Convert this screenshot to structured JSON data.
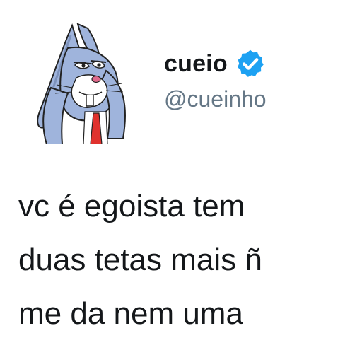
{
  "tweet": {
    "author": {
      "display_name": "cueio",
      "handle": "@cueinho",
      "verified": true,
      "avatar_icon": "bugs-bunny-avatar-icon",
      "verified_icon": "verified-badge-icon"
    },
    "text_lines": [
      "vc é egoista tem",
      "duas tetas mais ñ",
      "me da nem uma"
    ]
  },
  "colors": {
    "verified_blue": "#1da1f2",
    "text_primary": "#14171a",
    "text_secondary": "#657786",
    "bunny_blue": "#9fb4dc",
    "tie_red": "#e0322e"
  }
}
